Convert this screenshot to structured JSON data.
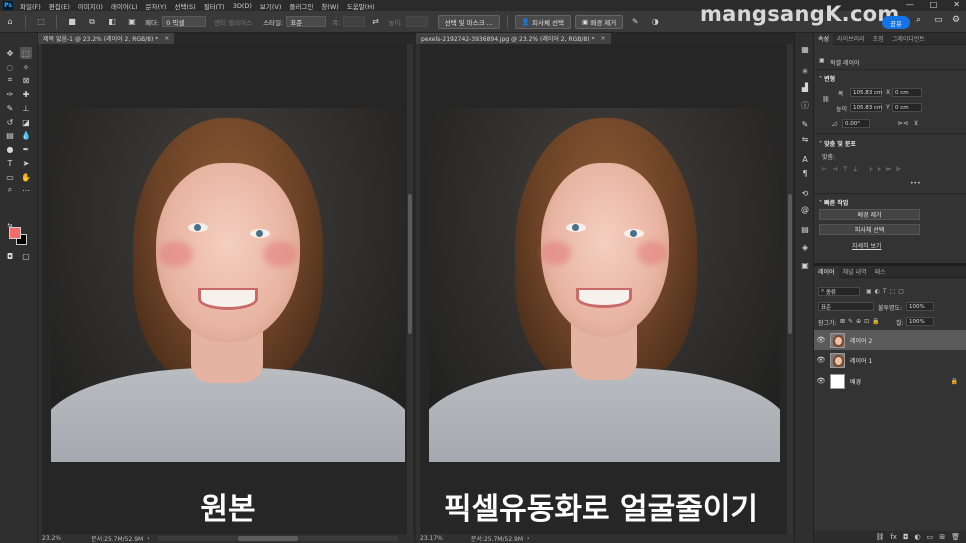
{
  "app": {
    "logo": "Ps",
    "menu": [
      "파일(F)",
      "편집(E)",
      "이미지(I)",
      "레이어(L)",
      "문자(Y)",
      "선택(S)",
      "필터(T)",
      "3D(D)",
      "보기(V)",
      "플러그인",
      "창(W)",
      "도움말(H)"
    ],
    "window_controls": [
      "—",
      "□",
      "✕"
    ]
  },
  "options": {
    "feather_label": "페더:",
    "feather_value": "0 픽셀",
    "antialias_label": "앤티 앨리어스",
    "style_label": "스타일:",
    "style_value": "표준",
    "width_label": "폭:",
    "height_label": "높이:",
    "select_mask_btn": "선택 및 마스크 ...",
    "select_subject_btn": "피사체 선택",
    "remove_bg_btn": "배경 제거",
    "share_btn": "공유",
    "brand": "mangsangK.com"
  },
  "documents": [
    {
      "tab": "제목 없음-1 @ 23.2% (레이어 2, RGB/8) *",
      "caption": "원본",
      "zoom": "23.2%",
      "doc_info": "문서:25.7M/52.9M"
    },
    {
      "tab": "pexels-2192742-3936894.jpg @ 23.2% (레이어 2, RGB/8) *",
      "caption": "픽셀유동화로 얼굴줄이기",
      "zoom": "23.17%",
      "doc_info": "문서:25.7M/52.9M"
    }
  ],
  "properties": {
    "tabs": [
      "속성",
      "라이브러리",
      "조정",
      "그레이디언트"
    ],
    "layer_type": "픽셀 레이어",
    "transform_label": "변형",
    "w_label": "폭",
    "w_value": "105.83 cm",
    "x_label": "X",
    "x_value": "0 cm",
    "h_label": "높이",
    "h_value": "105.83 cm",
    "y_label": "Y",
    "y_value": "0 cm",
    "angle_value": "0.00°",
    "align_label": "맞춤 및 분포",
    "align_sub": "맞춤:",
    "quick_actions_label": "빠른 작업",
    "quick_remove_bg": "배경 제거",
    "quick_select_subject": "피사체 선택",
    "more_link": "자세히 보기",
    "more_dots": "•••"
  },
  "layers_panel": {
    "tabs": [
      "레이어",
      "채널 내역",
      "패스"
    ],
    "kind_filter": "종류",
    "blend_mode": "표준",
    "opacity_label": "불투명도:",
    "opacity_value": "100%",
    "lock_label": "잠그기:",
    "fill_label": "칠:",
    "fill_value": "100%",
    "layers": [
      {
        "name": "레이어 2",
        "selected": true
      },
      {
        "name": "레이어 1",
        "selected": false
      },
      {
        "name": "배경",
        "selected": false
      }
    ],
    "bottom_icons": [
      "link-icon",
      "fx-icon",
      "mask-icon",
      "adjustment-icon",
      "group-icon",
      "new-layer-icon",
      "trash-icon"
    ]
  }
}
